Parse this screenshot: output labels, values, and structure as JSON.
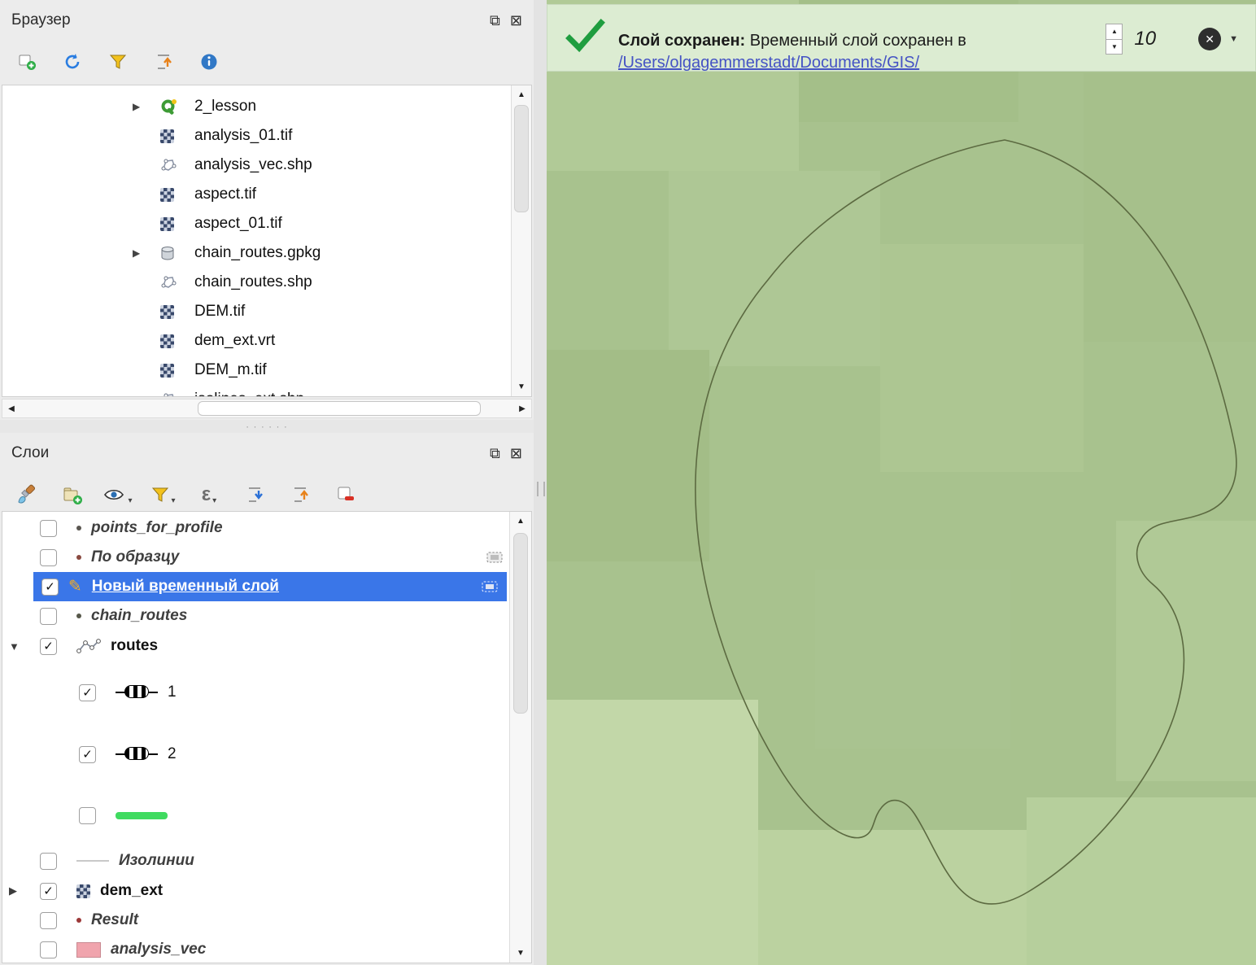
{
  "colors": {
    "panel_bg": "#ececec",
    "selection_blue": "#3a76e8",
    "message_bg": "#dcecd2",
    "link_blue": "#4553c4",
    "map_base": "#a8c28e",
    "blob_stroke": "#5c6a41",
    "route_green": "#40db60",
    "analysis_pink": "#f0a4ad",
    "check_green": "#1f9d3f"
  },
  "browser_panel": {
    "title": "Браузер",
    "toolbar_icons": [
      "add-layer-icon",
      "refresh-icon",
      "filter-browser-icon",
      "collapse-all-icon",
      "properties-icon"
    ],
    "items": [
      {
        "label": "2_lesson",
        "icon": "qgis-project-icon",
        "expandable": true
      },
      {
        "label": "analysis_01.tif",
        "icon": "raster-icon"
      },
      {
        "label": "analysis_vec.shp",
        "icon": "vector-icon"
      },
      {
        "label": "aspect.tif",
        "icon": "raster-icon"
      },
      {
        "label": "aspect_01.tif",
        "icon": "raster-icon"
      },
      {
        "label": "chain_routes.gpkg",
        "icon": "geopackage-icon",
        "expandable": true
      },
      {
        "label": "chain_routes.shp",
        "icon": "vector-icon"
      },
      {
        "label": "DEM.tif",
        "icon": "raster-icon"
      },
      {
        "label": "dem_ext.vrt",
        "icon": "raster-icon"
      },
      {
        "label": "DEM_m.tif",
        "icon": "raster-icon"
      },
      {
        "label": "isolines_ext.shp",
        "icon": "vector-icon"
      }
    ]
  },
  "layers_panel": {
    "title": "Слои",
    "toolbar_icons": [
      "layer-styling-icon",
      "add-group-icon",
      "manage-visibility-icon",
      "filter-legend-icon",
      "expression-filter-icon",
      "expand-all-icon",
      "collapse-all-icon",
      "remove-layer-icon"
    ],
    "layers": [
      {
        "label": "points_for_profile",
        "checked": false
      },
      {
        "label": "По образцу",
        "checked": false,
        "memory": true
      },
      {
        "label": "Новый временный слой",
        "checked": true,
        "selected": true,
        "editing": true,
        "memory": true
      },
      {
        "label": "chain_routes",
        "checked": false
      },
      {
        "label": "routes",
        "checked": true,
        "expanded": true,
        "children": [
          {
            "label": "1",
            "checked": true
          },
          {
            "label": "2",
            "checked": true
          },
          {
            "label": "",
            "checked": false
          }
        ]
      },
      {
        "label": "Изолинии",
        "checked": false
      },
      {
        "label": "dem_ext",
        "checked": true
      },
      {
        "label": "Result",
        "checked": false
      },
      {
        "label": "analysis_vec",
        "checked": false
      }
    ]
  },
  "message_bar": {
    "status_bold": "Слой сохранен:",
    "status_text": "Временный слой сохранен в",
    "saved_path": "/Users/olgagemmerstadt/Documents/GIS/",
    "countdown_value": "10"
  }
}
